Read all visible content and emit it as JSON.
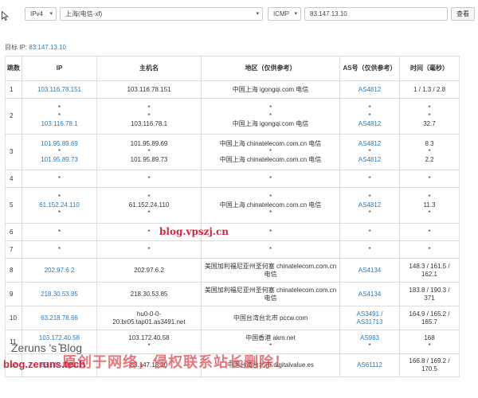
{
  "toolbar": {
    "ip_version": "IPv4",
    "location": "上海(电信-xf)",
    "protocol": "ICMP",
    "target_input": "83.147.13.10",
    "query_label": "查看"
  },
  "target_line": {
    "label": "目标 IP:",
    "value": "83.147.13.10"
  },
  "table": {
    "headers": {
      "hop": "跳数",
      "ip": "IP",
      "host": "主机名",
      "region": "地区（仅供参考）",
      "as": "AS号（仅供参考）",
      "time": "时间（毫秒）"
    },
    "rows": [
      {
        "hop": "1",
        "ip": [
          "103.116.78.151"
        ],
        "host": [
          "103.116.78.151"
        ],
        "region": [
          "中国上海 igongqi.com 电信"
        ],
        "as": [
          "AS4812"
        ],
        "time": [
          "1 / 1.3 / 2.8"
        ]
      },
      {
        "hop": "2",
        "ip": [
          "*",
          "*",
          "103.116.78.1"
        ],
        "host": [
          "*",
          "*",
          "103.116.78.1"
        ],
        "region": [
          "*",
          "*",
          "中国上海 igongqi.com 电信"
        ],
        "as": [
          "*",
          "*",
          "AS4812"
        ],
        "time": [
          "*",
          "*",
          "32.7"
        ]
      },
      {
        "hop": "3",
        "ip": [
          "101.95.89.69",
          "*",
          "101.95.89.73"
        ],
        "host": [
          "101.95.89.69",
          "*",
          "101.95.89.73"
        ],
        "region": [
          "中国上海 chinatelecom.com.cn 电信",
          "*",
          "中国上海 chinatelecom.com.cn 电信"
        ],
        "as": [
          "AS4812",
          "*",
          "AS4812"
        ],
        "time": [
          "8.3",
          "*",
          "2.2"
        ]
      },
      {
        "hop": "4",
        "ip": [
          "*"
        ],
        "host": [
          "*"
        ],
        "region": [
          "*"
        ],
        "as": [
          "*"
        ],
        "time": [
          "*"
        ]
      },
      {
        "hop": "5",
        "ip": [
          "*",
          "61.152.24.110",
          "*"
        ],
        "host": [
          "*",
          "61.152.24.110",
          "*"
        ],
        "region": [
          "*",
          "中国上海 chinatelecom.com.cn 电信",
          "*"
        ],
        "as": [
          "*",
          "AS4812",
          "*"
        ],
        "time": [
          "*",
          "11.3",
          "*"
        ]
      },
      {
        "hop": "6",
        "ip": [
          "*"
        ],
        "host": [
          "*"
        ],
        "region": [
          "*"
        ],
        "as": [
          "*"
        ],
        "time": [
          "*"
        ]
      },
      {
        "hop": "7",
        "ip": [
          "*"
        ],
        "host": [
          "*"
        ],
        "region": [
          "*"
        ],
        "as": [
          "*"
        ],
        "time": [
          "*"
        ]
      },
      {
        "hop": "8",
        "ip": [
          "202.97.6.2"
        ],
        "host": [
          "202.97.6.2"
        ],
        "region": [
          "美国加利福尼亚州圣何塞 chinatelecom.com.cn",
          "电信"
        ],
        "as": [
          "AS4134"
        ],
        "time": [
          "148.3 / 161.5 /",
          "162.1"
        ]
      },
      {
        "hop": "9",
        "ip": [
          "218.30.53.85"
        ],
        "host": [
          "218.30.53.85"
        ],
        "region": [
          "美国加利福尼亚州圣何塞 chinatelecom.com.cn",
          "电信"
        ],
        "as": [
          "AS4134"
        ],
        "time": [
          "183.8 / 190.3 /",
          "371"
        ]
      },
      {
        "hop": "10",
        "ip": [
          "63.218.78.66"
        ],
        "host": [
          "hu0-0-0-",
          "20.br05.tap01.as3491.net"
        ],
        "region": [
          "中国台湾台北市 pccw.com"
        ],
        "as": [
          "AS3491 /",
          "AS31713"
        ],
        "time": [
          "164.9 / 165.2 /",
          "165.7"
        ]
      },
      {
        "hop": "11",
        "ip": [
          "103.172.40.58",
          "*"
        ],
        "host": [
          "103.172.40.58",
          "*"
        ],
        "region": [
          "中国香港 akm.net",
          "*"
        ],
        "as": [
          "AS983",
          "*"
        ],
        "time": [
          "168",
          "*"
        ]
      },
      {
        "hop": "12",
        "ip": [
          "83.147.13.10"
        ],
        "host": [
          "83.147.13.10"
        ],
        "region": [
          "中国台湾台北市 digitalvalue.es"
        ],
        "as": [
          "AS61112"
        ],
        "time": [
          "166.8 / 169.2 /",
          "170.5"
        ]
      }
    ]
  },
  "watermarks": {
    "center": "blog.vpszj.cn",
    "blog_name": "Zeruns 's Blog",
    "blog_url": "blog.zeruns.tech",
    "notice": "原创于网络，侵权联系站长删除！"
  },
  "colors": {
    "link": "#2a7ab8",
    "watermark_red": "#d6243a",
    "border": "#dddddd"
  }
}
